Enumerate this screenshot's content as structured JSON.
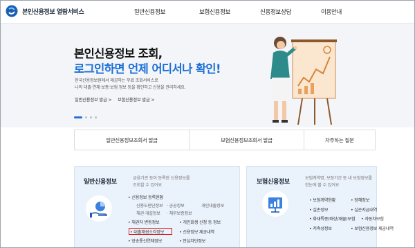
{
  "header": {
    "logo_text": "본인신용정보 열람서비스",
    "nav": [
      "일반신용정보",
      "보험신용정보",
      "신용정보상담",
      "이용안내"
    ]
  },
  "hero": {
    "title_line1": "본인신용정보 조회,",
    "title_line2": "로그인하면 언제 어디서나 확인!",
    "desc_line1": "한국신용정보원에서 제공하는 무료 조회서비스로",
    "desc_line2": "나의 대출·연체·보증·보험 정보 등을 확인하고 신용을 관리하세요.",
    "link1": "일반신용정보 발급",
    "link2": "보험신용정보 발급",
    "arrow": ">"
  },
  "quick_links": [
    "일반신용정보조회서 발급",
    "보험신용정보조회서 발급",
    "자주하는 질문"
  ],
  "general_card": {
    "title": "일반신용정보",
    "desc_line1": "금융기관 등이 등록한 신용정보를",
    "desc_line2": "조회할 수 있어요",
    "item_status": "신용정보 등록현황",
    "sub_items": [
      "신용도판단정보",
      "공공정보",
      "개인대출정보",
      "채권·개설정보",
      "채무보증정보"
    ],
    "item_change": "채권자 변동정보",
    "item_rehab": "개인회생 신청 등 정보",
    "item_loan_transfer": "대출채권소각정보",
    "item_insurance_provide": "신용정보 제공내역",
    "item_notice": "방송통신연체정보",
    "item_safe": "안심차단정보"
  },
  "insurance_card": {
    "title": "보험신용정보",
    "desc_line1": "보험계약명, 보장기간 등 내 보험정보를",
    "desc_line2": "한눈에 볼 수 있어요",
    "items": [
      "보험계약현황",
      "장해정보",
      "실손정보",
      "실손지급내역",
      "화재특종(배상/재물)보험",
      "자동차보험",
      "저축성정보",
      "보험신용정보 제공내역"
    ]
  },
  "colors": {
    "accent": "#1c6fd8",
    "hero_bg": "#f3f5f8",
    "card_bg": "#eaf2fb",
    "highlight": "#e01e1e"
  }
}
